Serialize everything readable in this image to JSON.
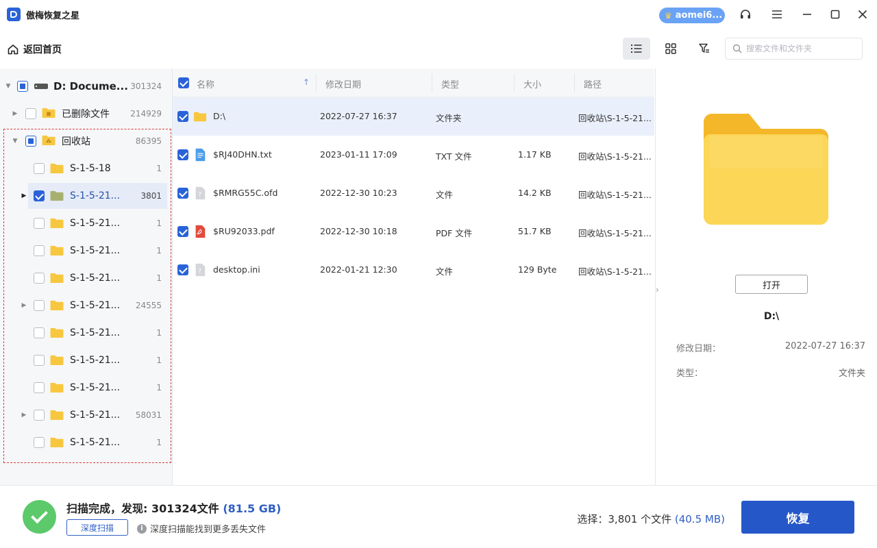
{
  "app": {
    "title": "傲梅恢复之星",
    "user": "aomei6..."
  },
  "toolbar": {
    "back_label": "返回首页",
    "search_placeholder": "搜索文件和文件夹"
  },
  "sidebar": {
    "root": {
      "label": "D: Docume...",
      "count": "301324"
    },
    "items": [
      {
        "label": "已删除文件",
        "count": "214929"
      },
      {
        "label": "回收站",
        "count": "86395"
      },
      {
        "label": "S-1-5-18",
        "count": "1"
      },
      {
        "label": "S-1-5-21...",
        "count": "3801"
      },
      {
        "label": "S-1-5-21...",
        "count": "1"
      },
      {
        "label": "S-1-5-21...",
        "count": "1"
      },
      {
        "label": "S-1-5-21...",
        "count": "1"
      },
      {
        "label": "S-1-5-21...",
        "count": "24555"
      },
      {
        "label": "S-1-5-21...",
        "count": "1"
      },
      {
        "label": "S-1-5-21...",
        "count": "1"
      },
      {
        "label": "S-1-5-21...",
        "count": "1"
      },
      {
        "label": "S-1-5-21...",
        "count": "58031"
      },
      {
        "label": "S-1-5-21...",
        "count": "1"
      }
    ]
  },
  "list": {
    "columns": {
      "name": "名称",
      "date": "修改日期",
      "type": "类型",
      "size": "大小",
      "path": "路径"
    },
    "rows": [
      {
        "name": "D:\\",
        "date": "2022-07-27 16:37",
        "type": "文件夹",
        "size": "",
        "path": "回收站\\S-1-5-21...",
        "icon": "folder-icon"
      },
      {
        "name": "$RJ40DHN.txt",
        "date": "2023-01-11 17:09",
        "type": "TXT 文件",
        "size": "1.17 KB",
        "path": "回收站\\S-1-5-21...",
        "icon": "txt-file-icon"
      },
      {
        "name": "$RMRG55C.ofd",
        "date": "2022-12-30 10:23",
        "type": "文件",
        "size": "14.2 KB",
        "path": "回收站\\S-1-5-21...",
        "icon": "unknown-file-icon"
      },
      {
        "name": "$RU92033.pdf",
        "date": "2022-12-30 10:18",
        "type": "PDF 文件",
        "size": "51.7 KB",
        "path": "回收站\\S-1-5-21...",
        "icon": "pdf-file-icon"
      },
      {
        "name": "desktop.ini",
        "date": "2022-01-21 12:30",
        "type": "文件",
        "size": "129 Byte",
        "path": "回收站\\S-1-5-21...",
        "icon": "unknown-file-icon"
      }
    ]
  },
  "preview": {
    "open_label": "打开",
    "name": "D:\\",
    "modified_label": "修改日期：",
    "modified_value": "2022-07-27 16:37",
    "type_label": "类型：",
    "type_value": "文件夹"
  },
  "bottom": {
    "status_prefix": "扫描完成，发现: 301324文件",
    "status_size": "(81.5 GB)",
    "deep_scan_label": "深度扫描",
    "deep_scan_tip": "深度扫描能找到更多丢失文件",
    "selection_prefix": "选择：3,801 个文件",
    "selection_size": "(40.5 MB)",
    "recover_label": "恢复"
  },
  "colors": {
    "accent": "#2557c9",
    "success": "#5cc96b",
    "folder": "#f7c740",
    "highlight_border": "#d43c3c"
  }
}
